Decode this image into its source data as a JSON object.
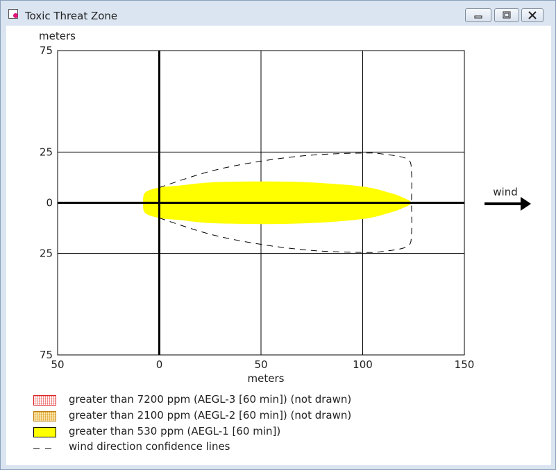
{
  "window": {
    "title": "Toxic Threat Zone"
  },
  "chart_data": {
    "type": "area",
    "xlabel": "meters",
    "ylabel": "meters",
    "xlim": [
      -50,
      150
    ],
    "ylim": [
      -75,
      75
    ],
    "x_ticks": [
      {
        "value": -50,
        "label": "50"
      },
      {
        "value": 0,
        "label": "0"
      },
      {
        "value": 50,
        "label": "50"
      },
      {
        "value": 100,
        "label": "100"
      },
      {
        "value": 150,
        "label": "150"
      }
    ],
    "y_ticks": [
      {
        "value": 75,
        "label": "75"
      },
      {
        "value": 25,
        "label": "25"
      },
      {
        "value": 0,
        "label": "0"
      },
      {
        "value": -25,
        "label": "25"
      },
      {
        "value": -75,
        "label": "75"
      }
    ],
    "grid": true,
    "wind": {
      "label": "wind",
      "direction": "right"
    },
    "zones": [
      {
        "name": "greater than 530 ppm (AEGL-1 [60 min])",
        "color": "#ffff00",
        "upper_edge": [
          [
            -8,
            0
          ],
          [
            -7,
            5
          ],
          [
            0,
            7.5
          ],
          [
            10,
            8.5
          ],
          [
            25,
            10
          ],
          [
            50,
            10.5
          ],
          [
            75,
            10
          ],
          [
            100,
            8
          ],
          [
            113,
            5
          ],
          [
            120,
            2.5
          ],
          [
            124,
            0
          ]
        ],
        "lower_edge": [
          [
            -8,
            0
          ],
          [
            -7,
            -5
          ],
          [
            0,
            -7.5
          ],
          [
            10,
            -8.5
          ],
          [
            25,
            -10
          ],
          [
            50,
            -10.5
          ],
          [
            75,
            -10
          ],
          [
            100,
            -8
          ],
          [
            113,
            -5
          ],
          [
            120,
            -2.5
          ],
          [
            124,
            0
          ]
        ]
      }
    ],
    "confidence_lines": {
      "name": "wind direction confidence lines",
      "upper": [
        [
          0,
          7.5
        ],
        [
          25,
          15.5
        ],
        [
          50,
          20.5
        ],
        [
          75,
          23.5
        ],
        [
          100,
          24.5
        ],
        [
          110,
          24
        ],
        [
          122,
          21.5
        ],
        [
          124,
          15
        ],
        [
          124,
          0
        ]
      ],
      "lower": [
        [
          0,
          -7.5
        ],
        [
          25,
          -15.5
        ],
        [
          50,
          -20.5
        ],
        [
          75,
          -23.5
        ],
        [
          100,
          -24.5
        ],
        [
          110,
          -24
        ],
        [
          122,
          -21.5
        ],
        [
          124,
          -15
        ],
        [
          124,
          0
        ]
      ]
    },
    "legend": [
      {
        "label": "greater than 7200 ppm (AEGL-3 [60 min]) (not drawn)",
        "color": "#e84040",
        "pattern": "dotted"
      },
      {
        "label": "greater than 2100 ppm (AEGL-2 [60 min]) (not drawn)",
        "color": "#e8a020",
        "pattern": "dotted"
      },
      {
        "label": "greater than 530 ppm (AEGL-1 [60 min])",
        "color": "#ffff00",
        "pattern": "solid"
      },
      {
        "label": "wind direction confidence lines",
        "color": "#000000",
        "pattern": "dashed"
      }
    ]
  }
}
